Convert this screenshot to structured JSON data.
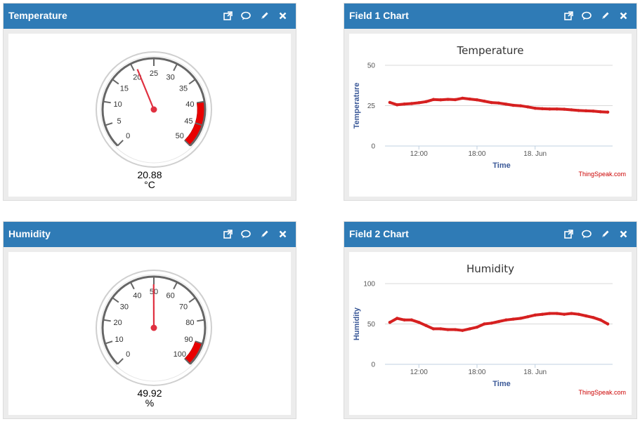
{
  "colors": {
    "header": "#2f7bb6",
    "series": "#d62020",
    "band": "#e80000",
    "axis_title": "#3b5998"
  },
  "widgets": [
    {
      "id": "temp-gauge",
      "title": "Temperature",
      "icons": [
        "external-link-icon",
        "comment-icon",
        "pencil-icon",
        "close-icon"
      ],
      "gauge": {
        "min": 0,
        "max": 50,
        "ticks": [
          "0",
          "5",
          "10",
          "15",
          "20",
          "25",
          "30",
          "35",
          "40",
          "45",
          "50"
        ],
        "band_from": 40,
        "band_to": 50,
        "value": 20.88,
        "value_label": "20.88",
        "unit": "°C"
      }
    },
    {
      "id": "field1-chart",
      "title": "Field 1 Chart",
      "icons": [
        "external-link-icon",
        "comment-icon",
        "pencil-icon",
        "close-icon"
      ]
    },
    {
      "id": "hum-gauge",
      "title": "Humidity",
      "icons": [
        "external-link-icon",
        "comment-icon",
        "pencil-icon",
        "close-icon"
      ],
      "gauge": {
        "min": 0,
        "max": 100,
        "ticks": [
          "0",
          "10",
          "20",
          "30",
          "40",
          "50",
          "60",
          "70",
          "80",
          "90",
          "100"
        ],
        "band_from": 90,
        "band_to": 100,
        "value": 49.92,
        "value_label": "49.92",
        "unit": "%"
      }
    },
    {
      "id": "field2-chart",
      "title": "Field 2 Chart",
      "icons": [
        "external-link-icon",
        "comment-icon",
        "pencil-icon",
        "close-icon"
      ]
    }
  ],
  "credit": "ThingSpeak.com",
  "chart_data": [
    {
      "type": "line",
      "title": "Temperature",
      "xlabel": "Time",
      "ylabel": "Temperature",
      "ylim": [
        0,
        50
      ],
      "yticks": [
        "0",
        "25",
        "50"
      ],
      "xlim": [
        "2024-06-17T08:30",
        "2024-06-18T08:00"
      ],
      "xticks": [
        "12:00",
        "18:00",
        "18. Jun"
      ],
      "xtick_times": [
        "2024-06-17T12:00",
        "2024-06-17T18:00",
        "2024-06-18T00:00"
      ],
      "series": [
        {
          "color": "#d62020",
          "x": [
            "2024-06-17T09:00",
            "2024-06-17T09:45",
            "2024-06-17T10:30",
            "2024-06-17T11:15",
            "2024-06-17T12:00",
            "2024-06-17T12:45",
            "2024-06-17T13:30",
            "2024-06-17T14:15",
            "2024-06-17T15:00",
            "2024-06-17T15:45",
            "2024-06-17T16:30",
            "2024-06-17T17:15",
            "2024-06-17T18:00",
            "2024-06-17T18:45",
            "2024-06-17T19:30",
            "2024-06-17T20:15",
            "2024-06-17T21:00",
            "2024-06-17T21:45",
            "2024-06-17T22:30",
            "2024-06-17T23:15",
            "2024-06-18T00:00",
            "2024-06-18T00:45",
            "2024-06-18T01:30",
            "2024-06-18T02:15",
            "2024-06-18T03:00",
            "2024-06-18T03:45",
            "2024-06-18T04:30",
            "2024-06-18T05:15",
            "2024-06-18T06:00",
            "2024-06-18T06:45",
            "2024-06-18T07:30"
          ],
          "y": [
            27,
            25.5,
            26,
            26.3,
            26.8,
            27.5,
            28.8,
            28.6,
            28.9,
            28.7,
            29.6,
            29.1,
            28.6,
            27.8,
            26.9,
            26.6,
            25.9,
            25.2,
            24.9,
            24.2,
            23.4,
            23.1,
            22.9,
            22.9,
            22.8,
            22.4,
            22.0,
            21.8,
            21.6,
            21.2,
            21.0
          ]
        }
      ]
    },
    {
      "type": "line",
      "title": "Humidity",
      "xlabel": "Time",
      "ylabel": "Humidity",
      "ylim": [
        0,
        100
      ],
      "yticks": [
        "0",
        "50",
        "100"
      ],
      "xlim": [
        "2024-06-17T08:30",
        "2024-06-18T08:00"
      ],
      "xticks": [
        "12:00",
        "18:00",
        "18. Jun"
      ],
      "xtick_times": [
        "2024-06-17T12:00",
        "2024-06-17T18:00",
        "2024-06-18T00:00"
      ],
      "series": [
        {
          "color": "#d62020",
          "x": [
            "2024-06-17T09:00",
            "2024-06-17T09:45",
            "2024-06-17T10:30",
            "2024-06-17T11:15",
            "2024-06-17T12:00",
            "2024-06-17T12:45",
            "2024-06-17T13:30",
            "2024-06-17T14:15",
            "2024-06-17T15:00",
            "2024-06-17T15:45",
            "2024-06-17T16:30",
            "2024-06-17T17:15",
            "2024-06-17T18:00",
            "2024-06-17T18:45",
            "2024-06-17T19:30",
            "2024-06-17T20:15",
            "2024-06-17T21:00",
            "2024-06-17T21:45",
            "2024-06-17T22:30",
            "2024-06-17T23:15",
            "2024-06-18T00:00",
            "2024-06-18T00:45",
            "2024-06-18T01:30",
            "2024-06-18T02:15",
            "2024-06-18T03:00",
            "2024-06-18T03:45",
            "2024-06-18T04:30",
            "2024-06-18T05:15",
            "2024-06-18T06:00",
            "2024-06-18T06:45",
            "2024-06-18T07:30"
          ],
          "y": [
            52,
            57,
            55,
            55,
            52,
            48,
            44,
            44,
            43,
            43,
            42,
            44,
            46,
            50,
            51,
            53,
            55,
            56,
            57,
            59,
            61,
            62,
            63,
            63,
            62,
            63,
            62,
            60,
            58,
            55,
            50
          ]
        }
      ]
    }
  ]
}
